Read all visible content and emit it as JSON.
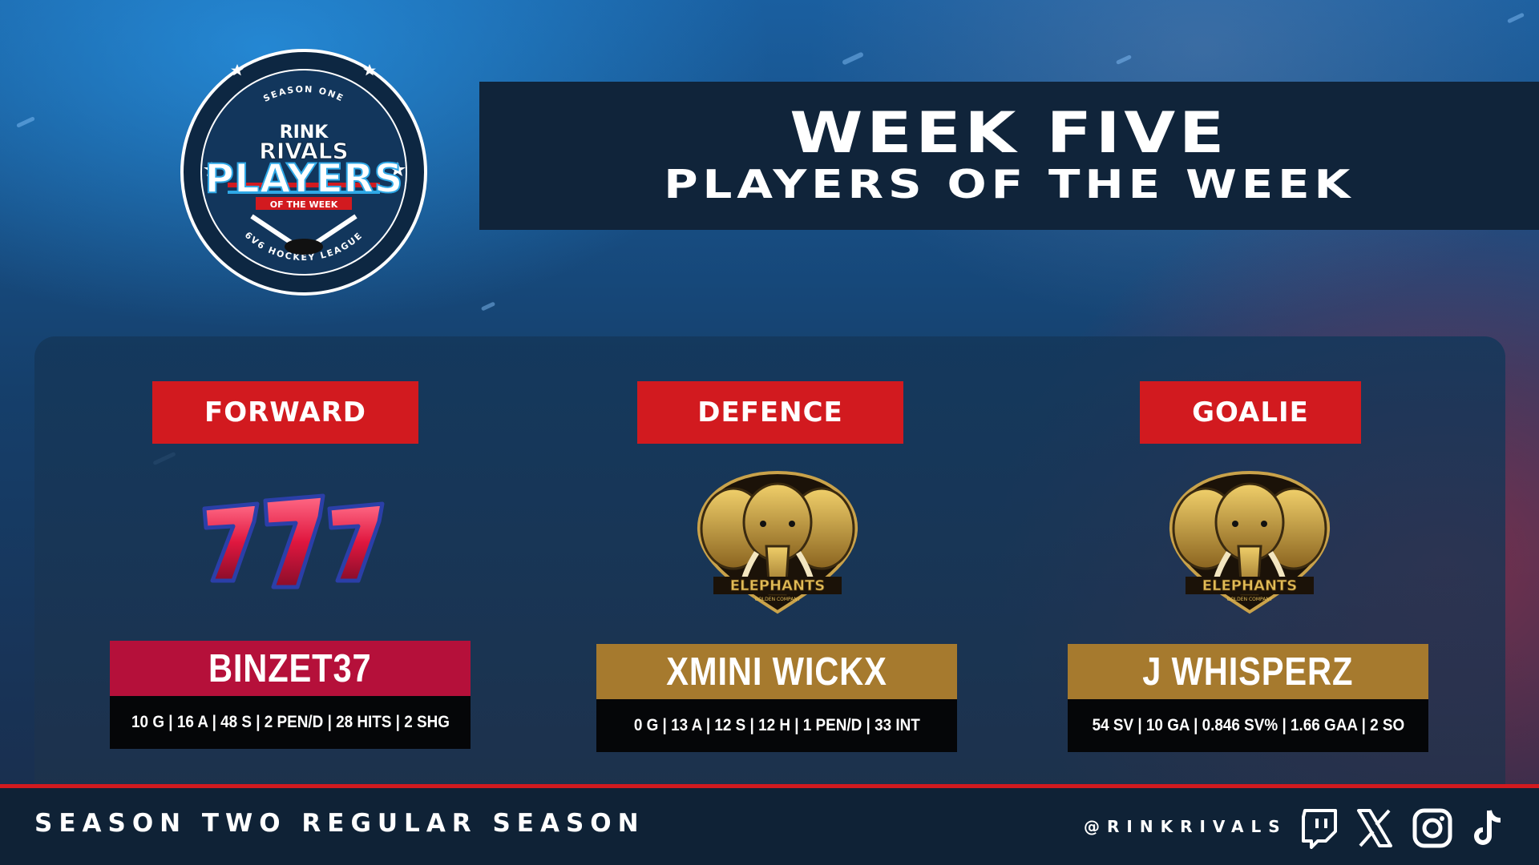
{
  "logo": {
    "top_text": "SEASON ONE",
    "brand": "RINK",
    "brand2": "RIVALS",
    "main": "PLAYERS",
    "sub": "OF THE WEEK",
    "bottom_text": "6V6 HOCKEY LEAGUE"
  },
  "title": {
    "line1": "WEEK FIVE",
    "line2": "PLAYERS OF THE WEEK"
  },
  "players": [
    {
      "position": "FORWARD",
      "team_logo": "777-logo",
      "name": "BINZET37",
      "stats": "10 G | 16 A | 48 S | 2 PEN/D | 28 HITS | 2 SHG",
      "bar_color": "#b5103a"
    },
    {
      "position": "DEFENCE",
      "team_logo": "elephant-logo",
      "team_name": "ELEPHANTS",
      "team_sub": "GOLDEN COMPANY",
      "name": "XMINI WICKX",
      "stats": "0 G | 13 A | 12 S | 12 H | 1 PEN/D | 33 INT",
      "bar_color": "#a67a2e"
    },
    {
      "position": "GOALIE",
      "team_logo": "elephant-logo",
      "team_name": "ELEPHANTS",
      "team_sub": "GOLDEN COMPANY",
      "name": "J WHISPERZ",
      "stats": "54 SV | 10 GA | 0.846 SV% | 1.66 GAA | 2 SO",
      "bar_color": "#a67a2e"
    }
  ],
  "footer": {
    "season": "SEASON TWO REGULAR SEASON",
    "handle": "@RINKRIVALS",
    "socials": [
      "twitch-icon",
      "x-icon",
      "instagram-icon",
      "tiktok-icon"
    ]
  },
  "colors": {
    "accent_red": "#d21a1f",
    "banner_navy": "#10243a",
    "gold": "#a67a2e",
    "crimson": "#b5103a"
  }
}
